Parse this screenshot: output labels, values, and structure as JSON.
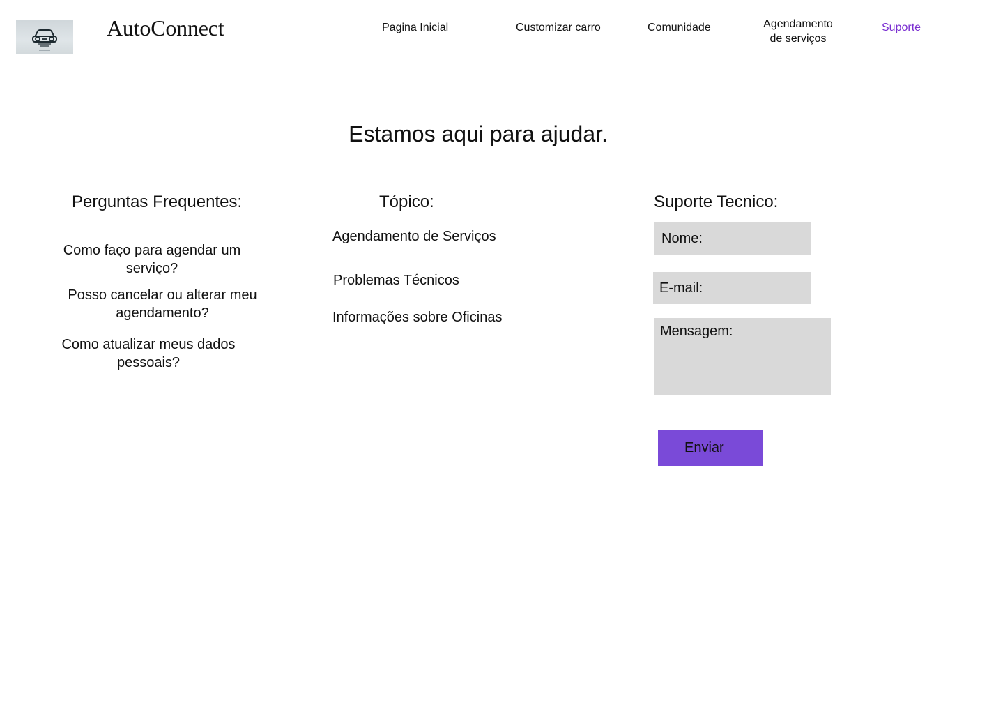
{
  "header": {
    "brand": "AutoConnect",
    "logo_icon": "car-icon",
    "nav": [
      {
        "label": "Pagina Inicial",
        "active": false
      },
      {
        "label": "Customizar carro",
        "active": false
      },
      {
        "label": "Comunidade",
        "active": false
      },
      {
        "label": "Agendamento de serviços",
        "active": false
      },
      {
        "label": "Suporte",
        "active": true
      }
    ]
  },
  "hero": {
    "title": "Estamos aqui para ajudar."
  },
  "faq": {
    "title": "Perguntas Frequentes:",
    "items": [
      "Como faço para agendar um serviço?",
      "Posso cancelar ou alterar meu agendamento?",
      "Como atualizar meus dados pessoais?"
    ]
  },
  "topics": {
    "title": "Tópico:",
    "items": [
      "Agendamento de Serviços",
      "Problemas Técnicos",
      "Informações sobre Oficinas"
    ]
  },
  "support": {
    "title": "Suporte Tecnico:",
    "name_label": "Nome:",
    "email_label": "E-mail:",
    "message_label": "Mensagem:",
    "submit_label": "Enviar"
  },
  "colors": {
    "accent": "#7a4ad8",
    "nav_active": "#7b2fd1",
    "field_bg": "#d9d9d9"
  }
}
